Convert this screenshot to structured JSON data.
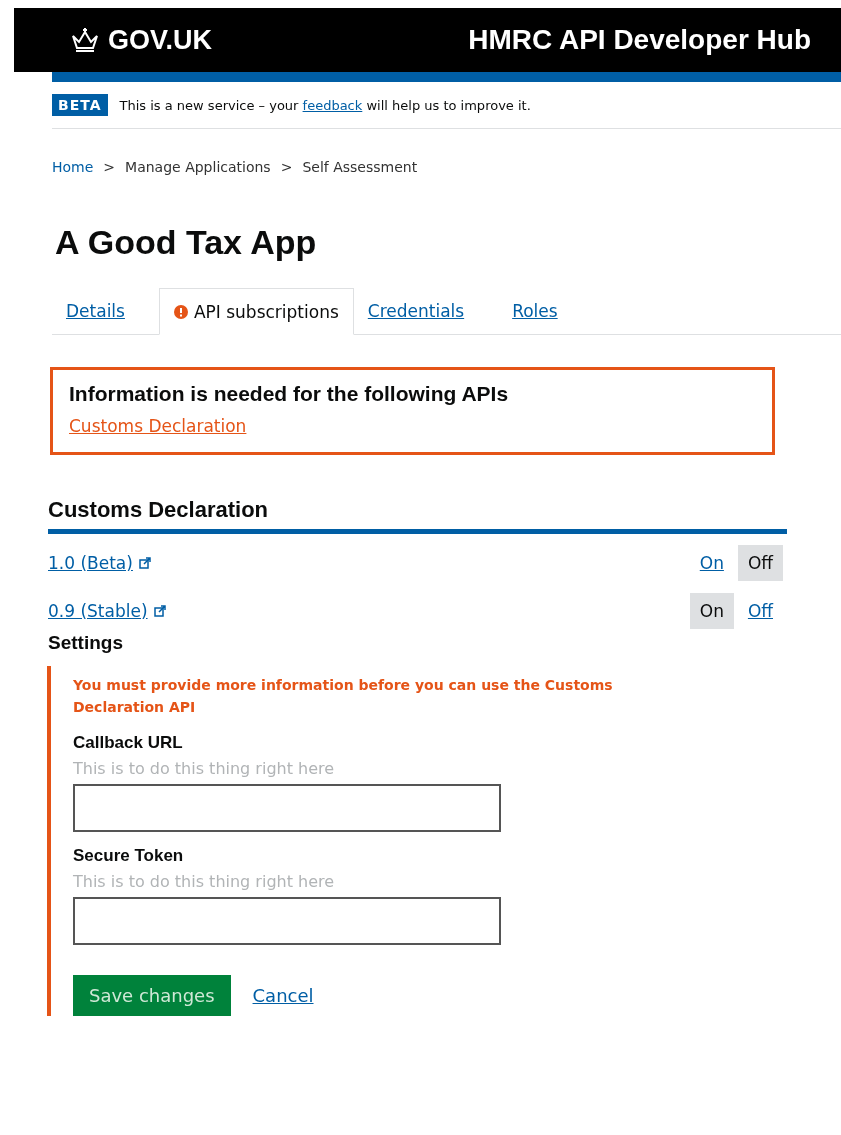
{
  "header": {
    "logo": "GOV.UK",
    "title": "HMRC API Developer Hub"
  },
  "beta_banner": {
    "tag": "BETA",
    "before": "This is a new service – your",
    "link": "feedback",
    "after": "will help us to improve it."
  },
  "breadcrumbs": [
    {
      "label": "Home",
      "link": true
    },
    {
      "label": ">",
      "link": false
    },
    {
      "label": "Manage Applications",
      "link": false
    },
    {
      "label": ">",
      "link": false
    },
    {
      "label": "Self Assessment",
      "link": false
    }
  ],
  "page_title": "A Good Tax App",
  "tabs": [
    {
      "label": "Details",
      "selected": false,
      "warning": false
    },
    {
      "label": "API subscriptions",
      "selected": true,
      "warning": true
    },
    {
      "label": "Credentials",
      "selected": false,
      "warning": false
    },
    {
      "label": "Roles",
      "selected": false,
      "warning": false
    }
  ],
  "error_summary": {
    "title": "Information is needed for the following APIs",
    "links": [
      "Customs Declaration"
    ]
  },
  "api": {
    "name": "Customs Declaration",
    "versions": [
      {
        "label": "1.0 (Beta)",
        "toggles": [
          {
            "label": "On",
            "selected": false
          },
          {
            "label": "Off",
            "selected": true
          }
        ]
      },
      {
        "label": "0.9 (Stable)",
        "toggles": [
          {
            "label": "On",
            "selected": true
          },
          {
            "label": "Off",
            "selected": false
          }
        ]
      }
    ]
  },
  "settings": {
    "title": "Settings",
    "error": "You must provide more information before you can use the Customs Declaration API",
    "fields": [
      {
        "label": "Callback URL",
        "hint": "This is to do this thing right here"
      },
      {
        "label": "Secure Token",
        "hint": "This is to do this thing right here"
      }
    ],
    "save": "Save changes",
    "cancel": "Cancel"
  }
}
